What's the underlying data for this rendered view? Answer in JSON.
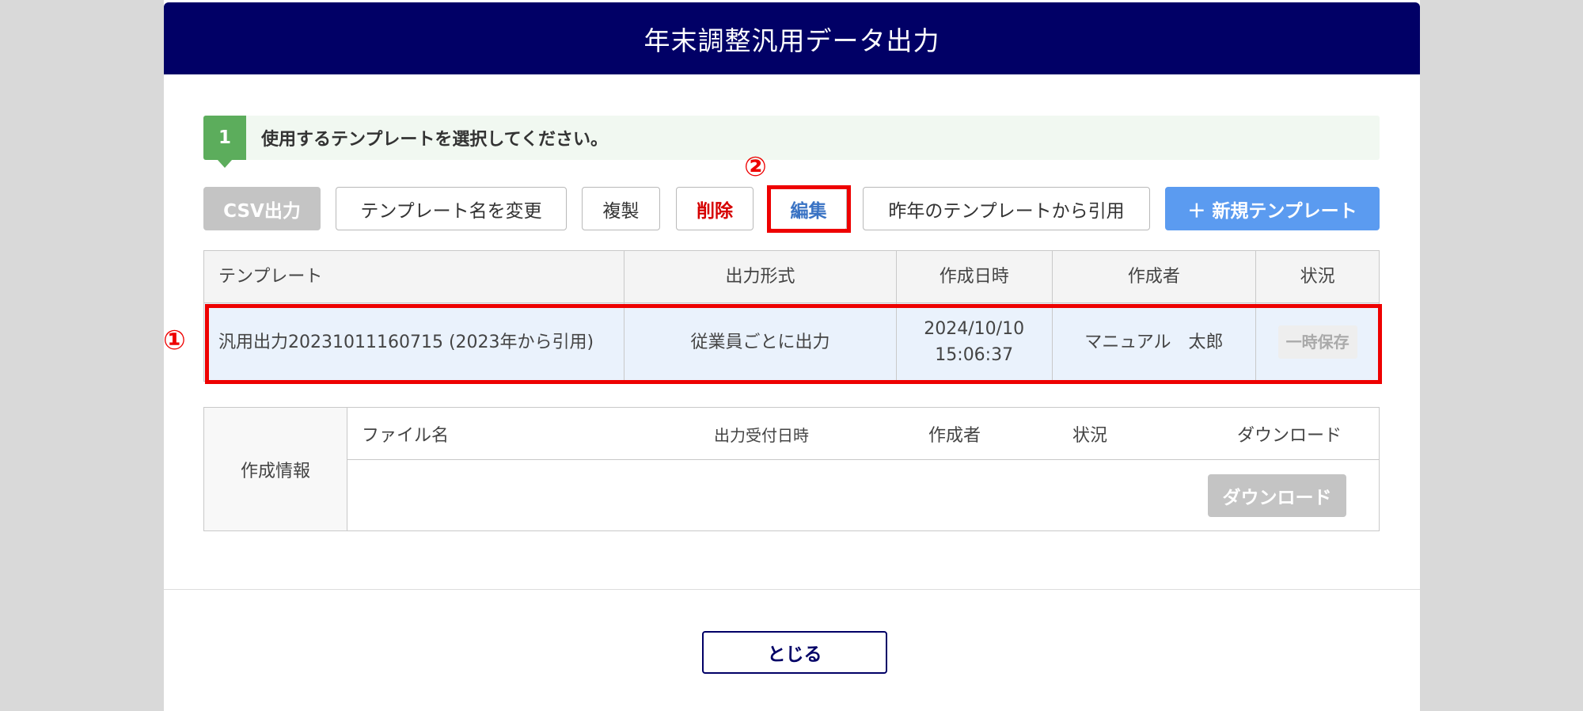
{
  "dialog": {
    "title": "年末調整汎用データ出力"
  },
  "step": {
    "number": "1",
    "text": "使用するテンプレートを選択してください。"
  },
  "toolbar": {
    "csv_label": "CSV出力",
    "rename_label": "テンプレート名を変更",
    "copy_label": "複製",
    "delete_label": "削除",
    "edit_label": "編集",
    "cite_label": "昨年のテンプレートから引用",
    "new_label": "＋ 新規テンプレート"
  },
  "annotations": {
    "marker1": "①",
    "marker2": "②"
  },
  "templates": {
    "columns": [
      "テンプレート",
      "出力形式",
      "作成日時",
      "作成者",
      "状況"
    ],
    "rows": [
      {
        "name": "汎用出力20231011160715 (2023年から引用)",
        "format": "従業員ごとに出力",
        "date": "2024/10/10",
        "time": "15:06:37",
        "author": "マニュアル　太郎",
        "status": "一時保存"
      }
    ]
  },
  "info": {
    "label": "作成情報",
    "columns": [
      "ファイル名",
      "出力受付日時",
      "作成者",
      "状況",
      "ダウンロード"
    ],
    "download_label": "ダウンロード"
  },
  "footer": {
    "close_label": "とじる"
  },
  "colors": {
    "title_bg": "#010066",
    "step_green": "#5cad5c",
    "new_btn": "#5b9bf0",
    "delete_text": "#d60000",
    "highlight": "#ee0000"
  }
}
